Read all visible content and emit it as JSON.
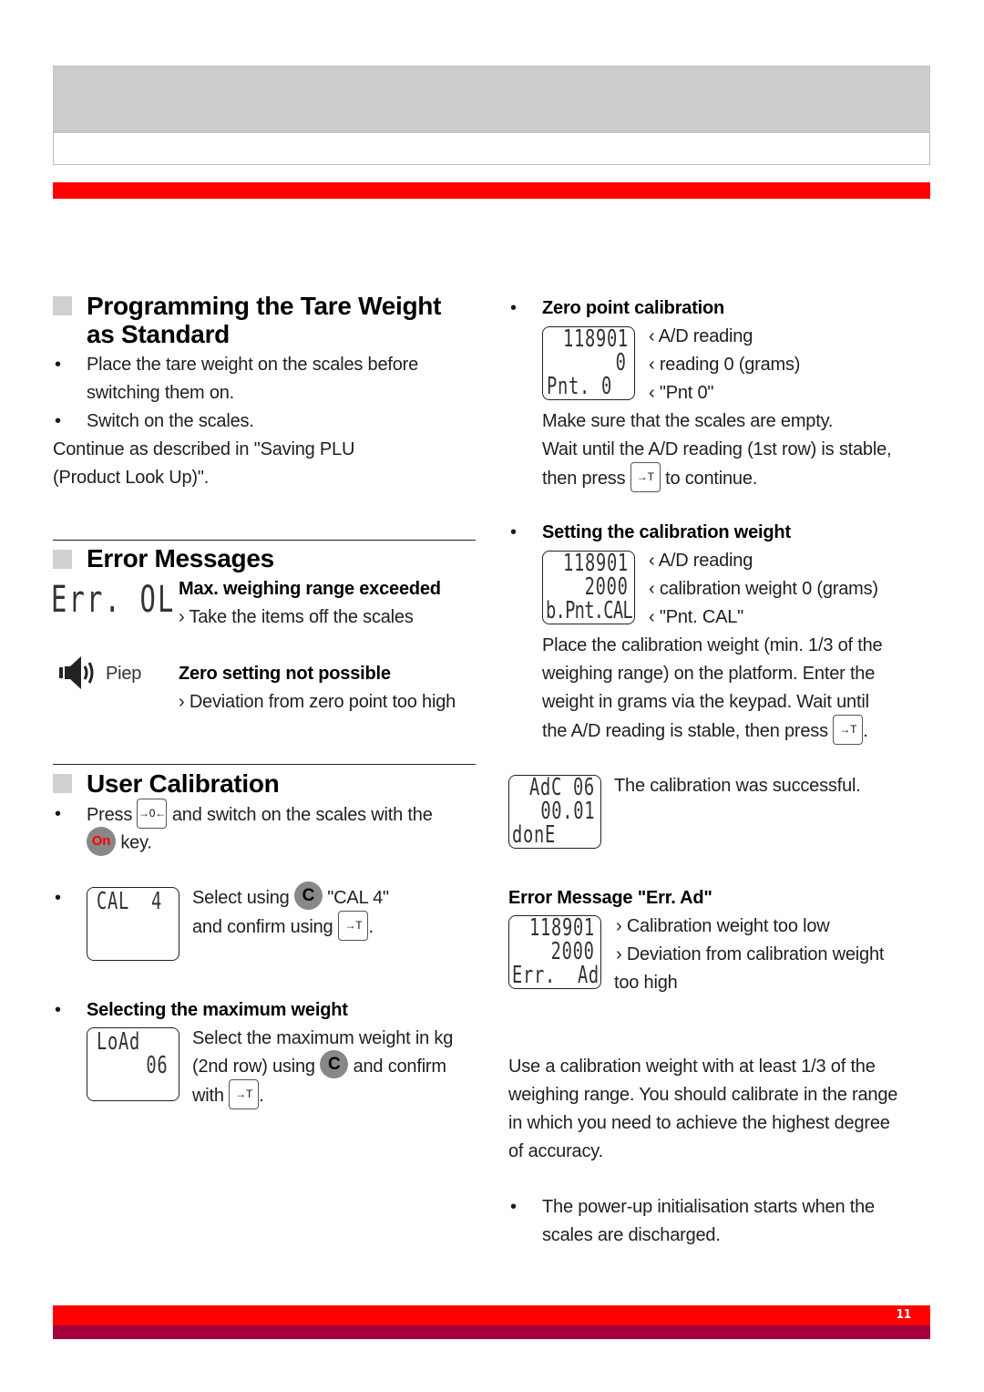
{
  "footer": {
    "page_number": "11"
  },
  "colors": {
    "accent_red": "#ff0000",
    "footer_maroon": "#a3003d",
    "header_gray": "#cdcdcd",
    "key_gray": "#888888"
  },
  "tare": {
    "title_line1": "Programming the Tare Weight",
    "title_line2": "as Standard",
    "bullets": [
      "Place the tare weight on the scales before",
      "switching them on.",
      "Switch on the scales."
    ],
    "continue_line1": "Continue as described in \"Saving PLU",
    "continue_line2": "(Product Look Up)\"."
  },
  "errors": {
    "title": "Error Messages",
    "err_ol": {
      "display": "Err. OL",
      "heading": "Max. weighing range exceeded",
      "detail": "› Take the items off the scales"
    },
    "piep": {
      "icon": "speaker-icon",
      "label": "Piep",
      "heading": "Zero setting not possible",
      "detail": "› Deviation from zero point too high"
    }
  },
  "user_cal": {
    "title": "User Calibration",
    "press_label": "Press",
    "zero_key": "→0←",
    "press_rest": "and switch on the scales with the",
    "on_key": "On",
    "key_label": "key.",
    "cal4": {
      "lcd_row1": "CAL  4",
      "line1_pre": "Select using",
      "c_key": "C",
      "line1_post": "\"CAL 4\"",
      "line2_pre": "and confirm using",
      "tare_key": "→T",
      "line2_post": "."
    },
    "max_weight": {
      "heading": "Selecting the maximum weight",
      "lcd_row1": "LoAd",
      "lcd_row2": "06",
      "line1": "Select the maximum weight in kg",
      "line2_pre": "(2nd row) using",
      "c_key": "C",
      "line2_post": "and confirm",
      "line3_pre": "with",
      "tare_key": "→T",
      "line3_post": "."
    }
  },
  "zero_point": {
    "heading": "Zero point calibration",
    "lcd": [
      "118901",
      "0",
      "Pnt. 0"
    ],
    "labels": [
      "‹ A/D reading",
      "‹ reading 0 (grams)",
      "‹ \"Pnt 0\""
    ],
    "text1": "Make sure that the scales are empty.",
    "text2": "Wait until the A/D reading (1st row) is stable,",
    "text3_pre": "then press",
    "tare_key": "→T",
    "text3_post": "to continue."
  },
  "cal_weight": {
    "heading": "Setting the calibration weight",
    "lcd": [
      "118901",
      "2000",
      "b.Pnt.CAL"
    ],
    "labels": [
      "‹ A/D reading",
      "‹ calibration weight 0 (grams)",
      "‹ \"Pnt. CAL\""
    ],
    "lines": [
      "Place the calibration weight (min. 1/3 of the",
      "weighing range) on the platform. Enter the",
      "weight in grams via the keypad. Wait until"
    ],
    "last_pre": "the A/D reading is stable, then press",
    "tare_key": "→T",
    "last_post": "."
  },
  "success": {
    "lcd": [
      "AdC 06",
      "00.01",
      "donE"
    ],
    "text": "The calibration was successful."
  },
  "err_ad": {
    "heading": "Error Message \"Err. Ad\"",
    "lcd": [
      "118901",
      "2000",
      "Err.  Ad"
    ],
    "lines": [
      "› Calibration weight too low",
      "› Deviation from calibration weight",
      "too high"
    ]
  },
  "note": {
    "lines": [
      "Use a calibration weight with at least 1/3 of the",
      "weighing range. You should calibrate in the range",
      "in which you need to achieve the highest degree",
      "of accuracy."
    ],
    "bullet_lines": [
      "The power-up initialisation starts when the",
      "scales are discharged."
    ]
  }
}
